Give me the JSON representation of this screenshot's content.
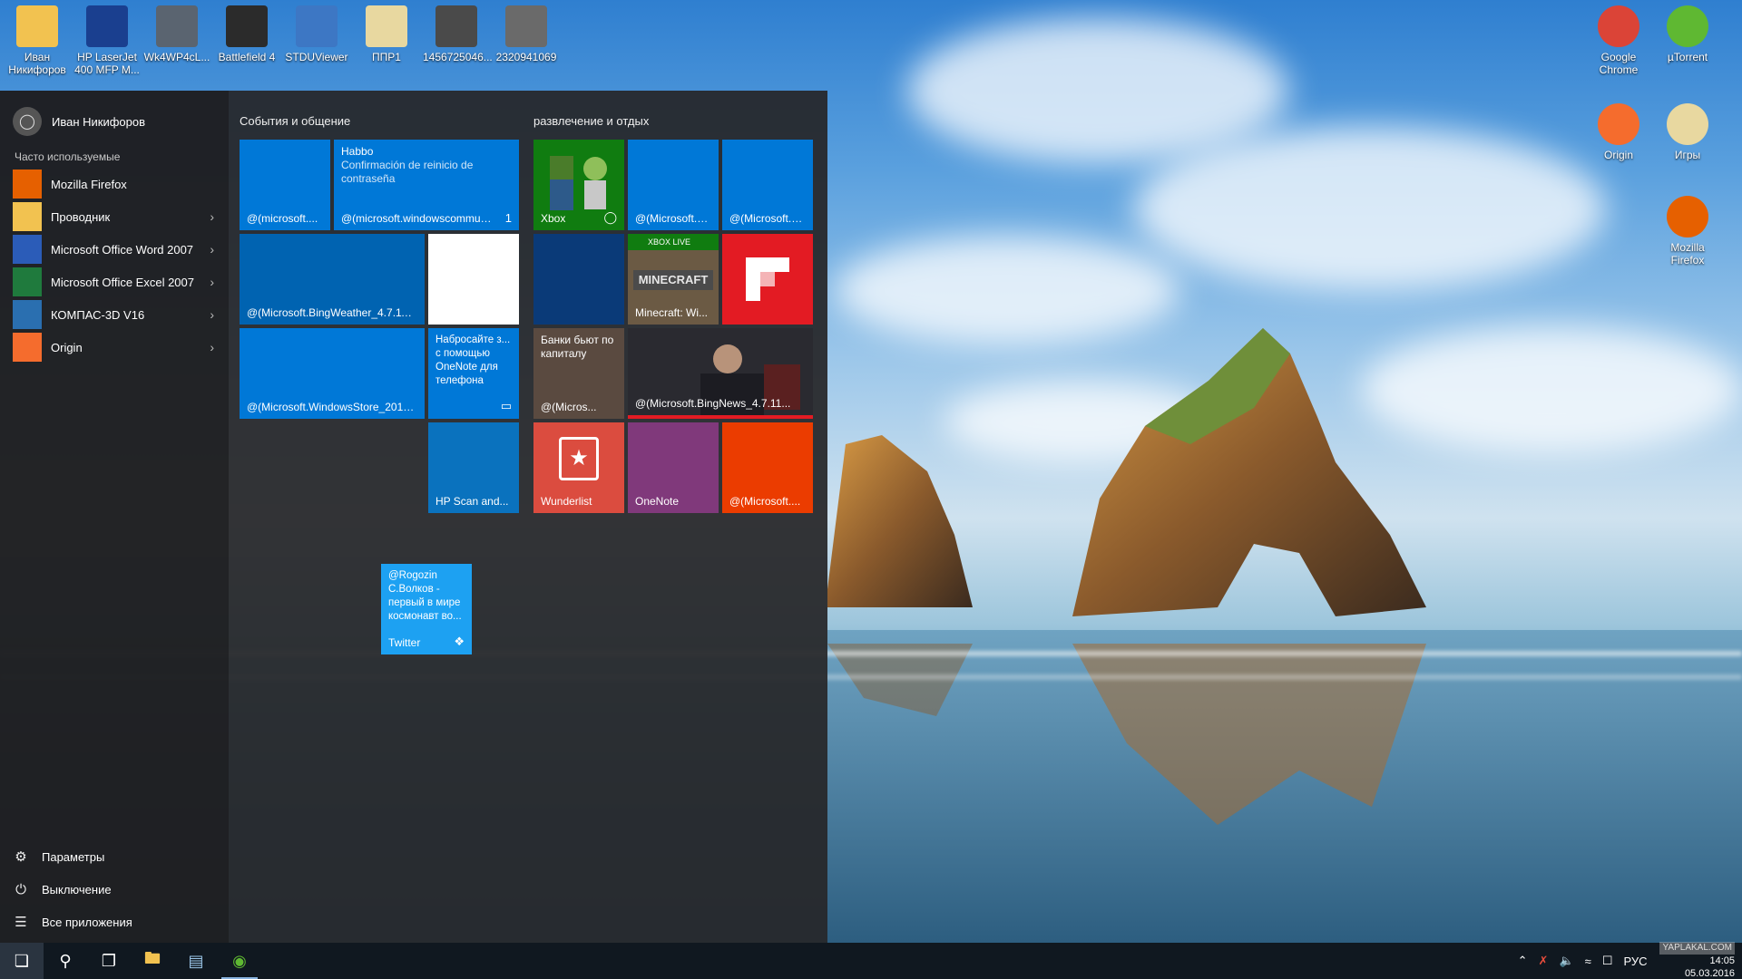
{
  "desktop": {
    "icons_left": [
      {
        "label": "Иван Никифоров",
        "icon": "user-folder-icon",
        "color": "#f2c250"
      },
      {
        "label": "HP LaserJet 400 MFP M...",
        "icon": "printer-help-icon",
        "color": "#1a3f8f"
      },
      {
        "label": "Wk4WP4cL...",
        "icon": "image-file-icon",
        "color": "#5a6470"
      },
      {
        "label": "Battlefield 4",
        "icon": "game-icon",
        "color": "#2b2b2b"
      },
      {
        "label": "STDUViewer",
        "icon": "magnifier-document-icon",
        "color": "#3d77c4"
      },
      {
        "label": "ППР1",
        "icon": "document-icon",
        "color": "#e8d8a0"
      },
      {
        "label": "1456725046...",
        "icon": "photo-icon",
        "color": "#4a4a4a"
      },
      {
        "label": "2320941069",
        "icon": "photo-icon",
        "color": "#6a6a6a"
      }
    ],
    "icons_right": [
      {
        "label": "Google Chrome",
        "icon": "chrome-icon",
        "color": "#db4437"
      },
      {
        "label": "µTorrent",
        "icon": "utorrent-icon",
        "color": "#5fb832"
      },
      {
        "label": "Origin",
        "icon": "origin-icon",
        "color": "#f56c2d"
      },
      {
        "label": "Игры",
        "icon": "games-folder-icon",
        "color": "#e8d8a0"
      },
      {
        "label": "Mozilla Firefox",
        "icon": "firefox-icon",
        "color": "#e66000"
      }
    ]
  },
  "start_menu": {
    "user_name": "Иван Никифоров",
    "frequent_label": "Часто используемые",
    "apps": [
      {
        "label": "Mozilla Firefox",
        "icon": "firefox-icon",
        "has_arrow": false,
        "color": "#e66000"
      },
      {
        "label": "Проводник",
        "icon": "folder-icon",
        "has_arrow": true,
        "color": "#f2c250"
      },
      {
        "label": "Microsoft Office Word 2007",
        "icon": "word-icon",
        "has_arrow": true,
        "color": "#2b5cb8"
      },
      {
        "label": "Microsoft Office Excel 2007",
        "icon": "excel-icon",
        "has_arrow": true,
        "color": "#1f7a3d"
      },
      {
        "label": "КОМПАС-3D V16",
        "icon": "kompas-icon",
        "has_arrow": true,
        "color": "#2a6fb0"
      },
      {
        "label": "Origin",
        "icon": "origin-icon",
        "has_arrow": true,
        "color": "#f56c2d"
      }
    ],
    "bottom": {
      "settings": "Параметры",
      "power": "Выключение",
      "all_apps": "Все приложения"
    },
    "groups": {
      "left_title": "События и общение",
      "right_title": "развлечение и отдых"
    },
    "tiles": {
      "mail": {
        "label": "@(microsoft...."
      },
      "habbo": {
        "title": "Habbo",
        "subtitle": "Confirmación de reinicio de contraseña",
        "label": "@(microsoft.windowscommun...",
        "badge": "1"
      },
      "weather": {
        "label": "@(Microsoft.BingWeather_4.7.118...."
      },
      "store": {
        "label": "@(Microsoft.WindowsStore_2015...."
      },
      "onenote_promo": {
        "text": "Набросайте з... с помощью OneNote для телефона"
      },
      "hp_scan": {
        "label": "HP Scan and..."
      },
      "twitter": {
        "text": "@Rogozin С.Волков - первый в мире космонавт во...",
        "label": "Twitter"
      },
      "xbox": {
        "label": "Xbox"
      },
      "zune1": {
        "label": "@(Microsoft.Z..."
      },
      "zune2": {
        "label": "@(Microsoft.Z..."
      },
      "minecraft": {
        "label": "Minecraft: Wi...",
        "top": "XBOX LIVE",
        "logo": "MINECRAFT"
      },
      "news_small": {
        "text": "Банки бьют по капиталу",
        "label": "@(Micros..."
      },
      "news_wide": {
        "label": "@(Microsoft.BingNews_4.7.11..."
      },
      "wunderlist": {
        "label": "Wunderlist"
      },
      "onenote": {
        "label": "OneNote"
      },
      "office": {
        "label": "@(Microsoft...."
      }
    }
  },
  "taskbar": {
    "language": "РУС",
    "time": "14:05",
    "date": "05.03.2016",
    "watermark": "YAPLAKAL.COM"
  },
  "colors": {
    "tile_blue": "#0078d7",
    "tile_dark_blue": "#0a3a78",
    "xbox_green": "#107c10",
    "flipboard_red": "#e31b23",
    "wunderlist_red": "#db4c3f",
    "onenote_purple": "#80397b",
    "office_orange": "#eb3c00",
    "twitter_blue": "#1da1f2"
  }
}
